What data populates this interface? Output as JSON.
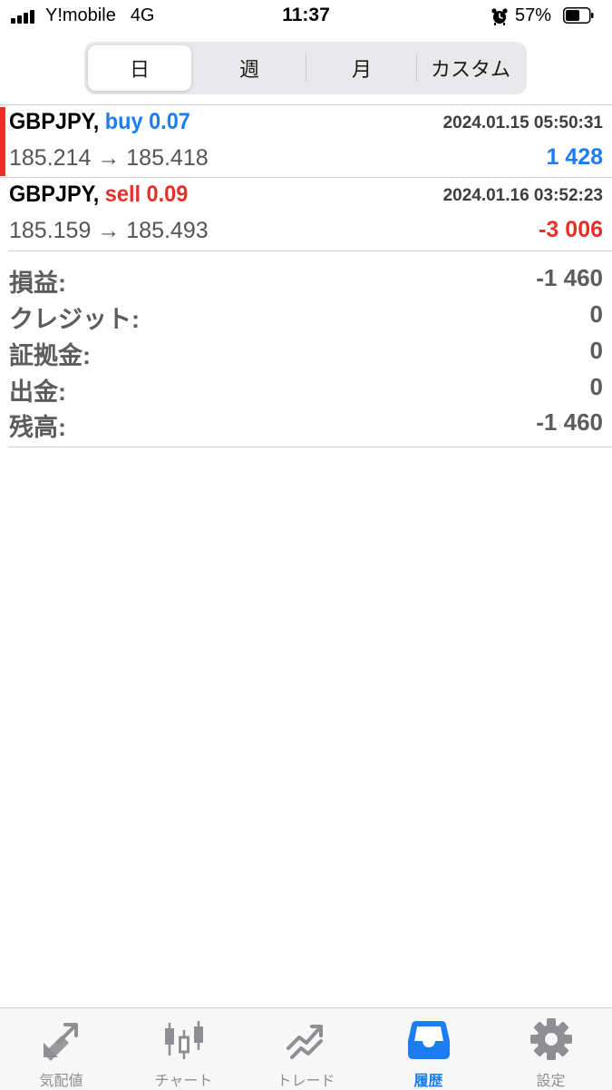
{
  "status_bar": {
    "carrier": "Y!mobile",
    "network": "4G",
    "time": "11:37",
    "battery_percent": "57%",
    "icons": [
      "signal-bars-icon",
      "alarm-icon",
      "battery-icon"
    ]
  },
  "period_tabs": {
    "items": [
      {
        "label": "日",
        "selected": true
      },
      {
        "label": "週",
        "selected": false
      },
      {
        "label": "月",
        "selected": false
      },
      {
        "label": "カスタム",
        "selected": false
      }
    ]
  },
  "colors": {
    "buy": "#1c7cf2",
    "sell": "#e5312a",
    "accent_bar": "#e5312a",
    "active_tab": "#1c7cf2",
    "inactive_tab": "#8e8e93"
  },
  "trades": [
    {
      "symbol": "GBPJPY,",
      "side_volume": "buy 0.07",
      "datetime": "2024.01.15 05:50:31",
      "prices": "185.214 → 185.418",
      "profit": "1 428"
    },
    {
      "symbol": "GBPJPY,",
      "side_volume": "sell 0.09",
      "datetime": "2024.01.16 03:52:23",
      "prices": "185.159 → 185.493",
      "profit": "-3 006"
    }
  ],
  "summary": {
    "profit": {
      "label": "損益:",
      "value": "-1 460"
    },
    "credit": {
      "label": "クレジット:",
      "value": "0"
    },
    "deposit": {
      "label": "証拠金:",
      "value": "0"
    },
    "withdrawal": {
      "label": "出金:",
      "value": "0"
    },
    "balance": {
      "label": "残高:",
      "value": "-1 460"
    }
  },
  "tab_bar": {
    "items": [
      {
        "label": "気配値",
        "icon": "quotes-arrows-icon",
        "active": false
      },
      {
        "label": "チャート",
        "icon": "candlestick-chart-icon",
        "active": false
      },
      {
        "label": "トレード",
        "icon": "trade-chart-icon",
        "active": false
      },
      {
        "label": "履歴",
        "icon": "inbox-tray-icon",
        "active": true
      },
      {
        "label": "設定",
        "icon": "gear-icon",
        "active": false
      }
    ]
  }
}
